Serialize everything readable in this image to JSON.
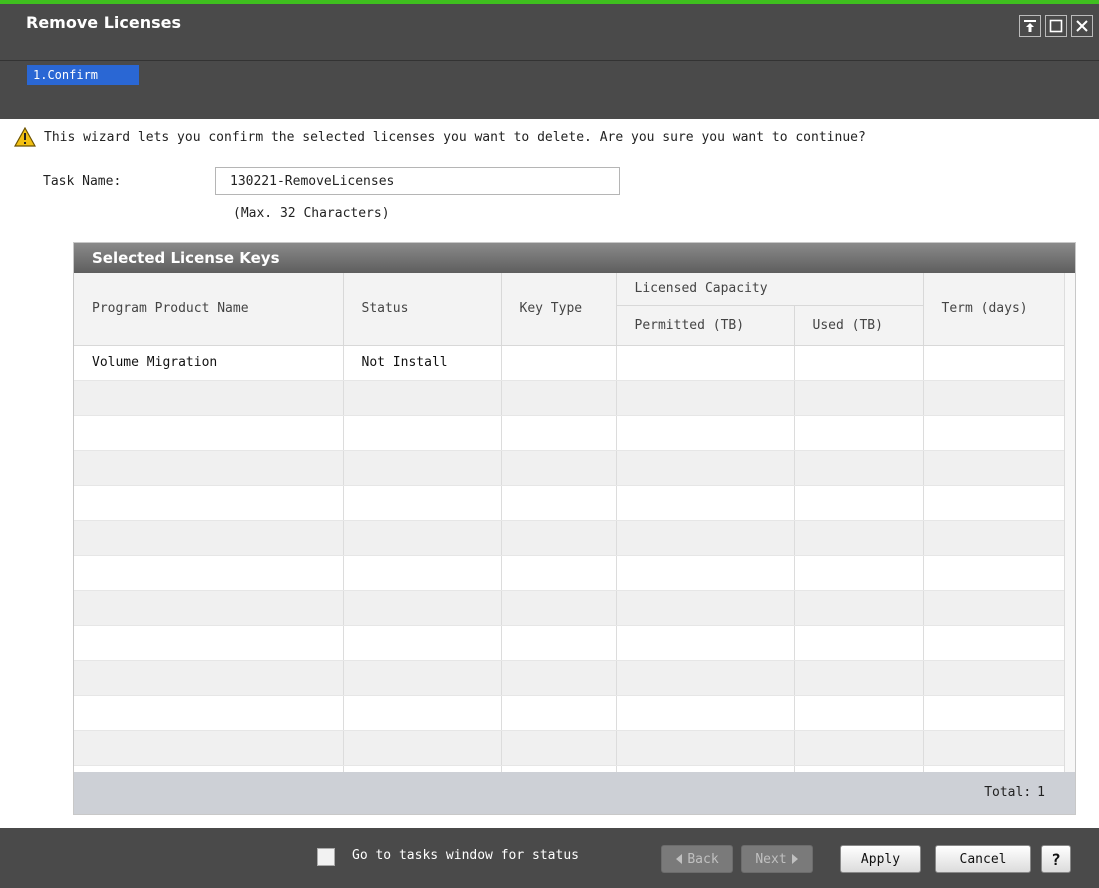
{
  "window": {
    "title": "Remove Licenses",
    "controls": [
      "pin-icon",
      "maximize-icon",
      "close-icon"
    ]
  },
  "steps": [
    {
      "label": "1.Confirm",
      "active": true
    }
  ],
  "warning": {
    "icon": "warning-icon",
    "text": "This wizard lets you confirm the selected licenses you want to delete. Are you sure you want to continue?"
  },
  "task": {
    "label": "Task Name:",
    "value": "130221-RemoveLicenses",
    "hint": "(Max. 32 Characters)"
  },
  "table": {
    "title": "Selected License Keys",
    "headers": {
      "program": "Program Product Name",
      "status": "Status",
      "key_type": "Key Type",
      "licensed_capacity": "Licensed Capacity",
      "permitted": "Permitted (TB)",
      "used": "Used (TB)",
      "term": "Term (days)"
    },
    "rows": [
      {
        "program": "Volume Migration",
        "status": "Not Install",
        "key_type": "",
        "permitted": "",
        "used": "",
        "term": ""
      }
    ],
    "total_label": "Total:",
    "total_value": "1"
  },
  "footer": {
    "checkbox_label": "Go to tasks window for status",
    "checkbox_checked": false,
    "back": "Back",
    "next": "Next",
    "apply": "Apply",
    "cancel": "Cancel",
    "help": "?"
  },
  "colors": {
    "accent_line": "#3fbf1f",
    "step_active": "#2a67d4",
    "chrome": "#4a4a4a"
  }
}
